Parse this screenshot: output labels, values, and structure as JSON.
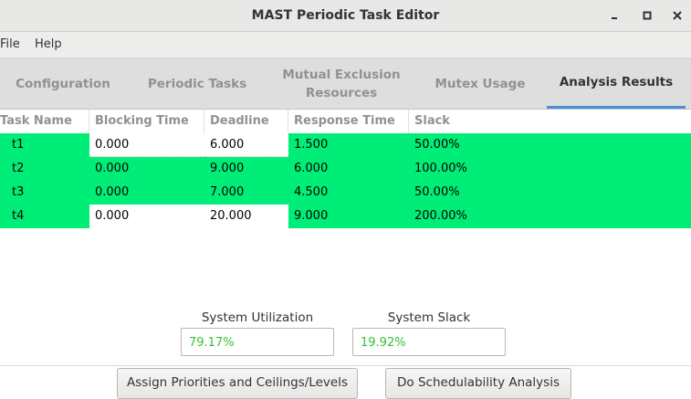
{
  "window": {
    "title": "MAST Periodic Task Editor"
  },
  "menu": {
    "items": [
      "File",
      "Help"
    ]
  },
  "tabs": [
    {
      "label": "Configuration",
      "active": false
    },
    {
      "label": "Periodic Tasks",
      "active": false
    },
    {
      "label": "Mutual Exclusion\nResources",
      "active": false
    },
    {
      "label": "Mutex Usage",
      "active": false
    },
    {
      "label": "Analysis Results",
      "active": true
    }
  ],
  "table": {
    "columns": [
      "Task Name",
      "Blocking Time",
      "Deadline",
      "Response Time",
      "Slack"
    ],
    "rows": [
      [
        "t1",
        "0.000",
        "6.000",
        "1.500",
        "50.00%"
      ],
      [
        "t2",
        "0.000",
        "9.000",
        "6.000",
        "100.00%"
      ],
      [
        "t3",
        "0.000",
        "7.000",
        "4.500",
        "50.00%"
      ],
      [
        "t4",
        "0.000",
        "20.000",
        "9.000",
        "200.00%"
      ]
    ]
  },
  "stats": {
    "utilization_label": "System Utilization",
    "utilization_value": "79.17%",
    "slack_label": "System Slack",
    "slack_value": "19.92%"
  },
  "buttons": {
    "assign_label": "Assign Priorities and Ceilings/Levels",
    "analysis_label": "Do Schedulability Analysis"
  },
  "colors": {
    "highlight": "#00ee77",
    "value_text": "#35c135",
    "active_tab_underline": "#4a90d9"
  }
}
